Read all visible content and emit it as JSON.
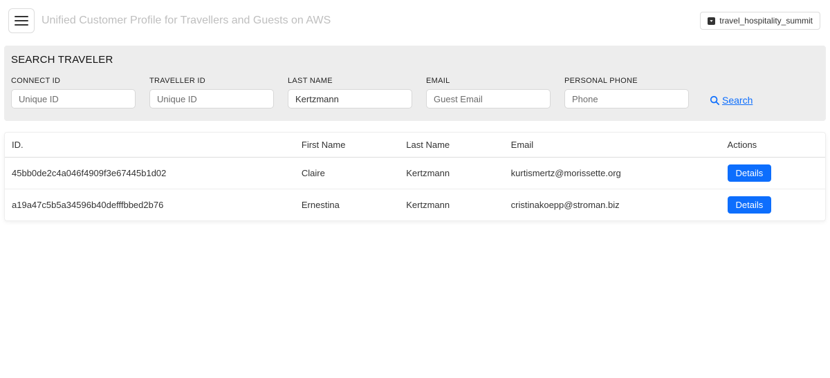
{
  "header": {
    "app_title": "Unified Customer Profile for Travellers and Guests on AWS",
    "domain_label": "travel_hospitality_summit"
  },
  "search_panel": {
    "title": "SEARCH TRAVELER",
    "fields": {
      "connect_id": {
        "label": "CONNECT ID",
        "placeholder": "Unique ID",
        "value": ""
      },
      "traveller_id": {
        "label": "TRAVELLER ID",
        "placeholder": "Unique ID",
        "value": ""
      },
      "last_name": {
        "label": "LAST NAME",
        "placeholder": "",
        "value": "Kertzmann"
      },
      "email": {
        "label": "EMAIL",
        "placeholder": "Guest Email",
        "value": ""
      },
      "phone": {
        "label": "PERSONAL PHONE",
        "placeholder": "Phone",
        "value": ""
      }
    },
    "search_link_label": "Search"
  },
  "results": {
    "columns": {
      "id": "ID.",
      "first_name": "First Name",
      "last_name": "Last Name",
      "email": "Email",
      "actions": "Actions"
    },
    "details_button_label": "Details",
    "rows": [
      {
        "id": "45bb0de2c4a046f4909f3e67445b1d02",
        "first_name": "Claire",
        "last_name": "Kertzmann",
        "email": "kurtismertz@morissette.org"
      },
      {
        "id": "a19a47c5b5a34596b40defffbbed2b76",
        "first_name": "Ernestina",
        "last_name": "Kertzmann",
        "email": "cristinakoepp@stroman.biz"
      }
    ]
  }
}
